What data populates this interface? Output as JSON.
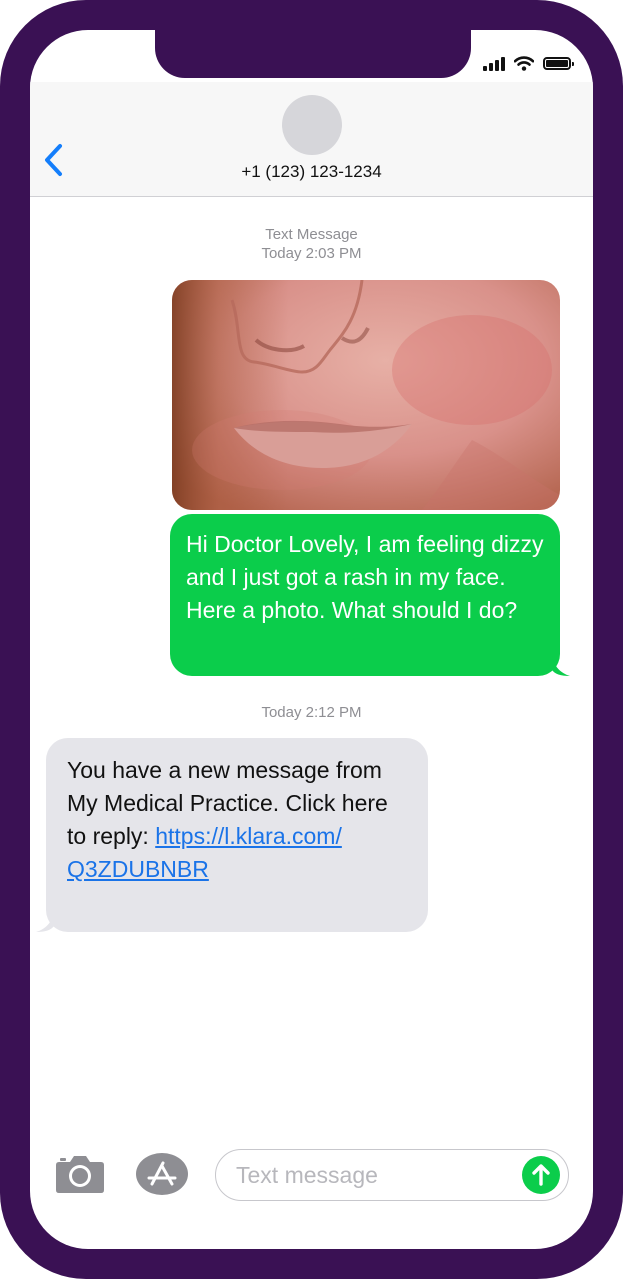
{
  "contact": {
    "number": "+1 (123) 123-1234"
  },
  "thread": {
    "service_label": "Text Message",
    "first_timestamp": "Today 2:03 PM",
    "second_timestamp": "Today 2:12 PM"
  },
  "messages": {
    "sent_text": "Hi Doctor Lovely, I am feeling dizzy and I just got a rash in my face. Here a photo. What should I do?",
    "received_text": "You have a new message from My Medical Practice. Click here to reply: ",
    "received_link": "https://l.klara.com/ Q3ZDUBNBR"
  },
  "composer": {
    "placeholder": "Text message"
  },
  "colors": {
    "frame": "#3a1154",
    "sent_bubble": "#0bcd4b",
    "received_bubble": "#e5e5ea",
    "link": "#1a73e8",
    "ios_blue": "#147efb"
  },
  "icons": {
    "back": "chevron-left-icon",
    "camera": "camera-icon",
    "app_store": "app-store-icon",
    "send": "arrow-up-icon",
    "signal": "cellular-signal-icon",
    "wifi": "wifi-icon",
    "battery": "battery-icon"
  }
}
